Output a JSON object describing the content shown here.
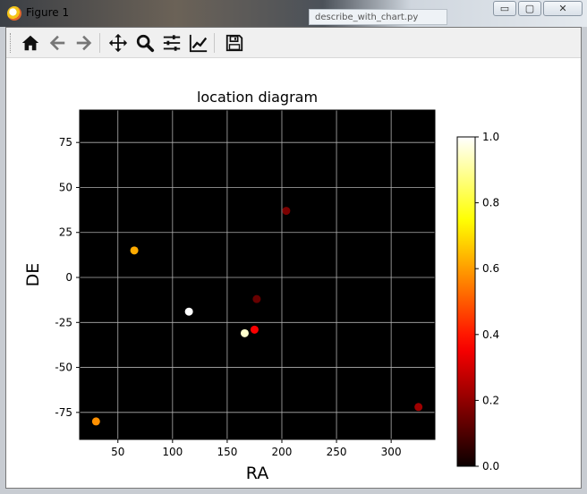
{
  "window": {
    "title": "Figure 1",
    "background_tab": "describe_with_chart.py"
  },
  "window_buttons": {
    "minimize": "▭",
    "maximize": "▢",
    "close": "✕"
  },
  "toolbar": {
    "buttons": [
      "home-icon",
      "back-icon",
      "forward-icon",
      "pan-icon",
      "zoom-icon",
      "configure-subplots-icon",
      "edit-axis-icon",
      "save-icon"
    ]
  },
  "chart_data": {
    "type": "scatter",
    "title": "location diagram",
    "xlabel": "RA",
    "ylabel": "DE",
    "xlim": [
      15,
      340
    ],
    "ylim": [
      -90,
      93
    ],
    "xticks": [
      50,
      100,
      150,
      200,
      250,
      300
    ],
    "yticks": [
      -75,
      -50,
      -25,
      0,
      25,
      50,
      75
    ],
    "grid": true,
    "background": "#000000",
    "grid_color": "#b0b0b0",
    "colormap": "hot",
    "colorbar": {
      "range": [
        0,
        1
      ],
      "ticks": [
        "0.0",
        "0.2",
        "0.4",
        "0.6",
        "0.8",
        "1.0"
      ]
    },
    "points": [
      {
        "x": 65,
        "y": 15,
        "c": 0.62
      },
      {
        "x": 30,
        "y": -80,
        "c": 0.58
      },
      {
        "x": 115,
        "y": -19,
        "c": 1.0
      },
      {
        "x": 166,
        "y": -31,
        "c": 0.95
      },
      {
        "x": 175,
        "y": -29,
        "c": 0.36
      },
      {
        "x": 177,
        "y": -12,
        "c": 0.14
      },
      {
        "x": 204,
        "y": 37,
        "c": 0.17
      },
      {
        "x": 325,
        "y": -72,
        "c": 0.22
      }
    ]
  }
}
